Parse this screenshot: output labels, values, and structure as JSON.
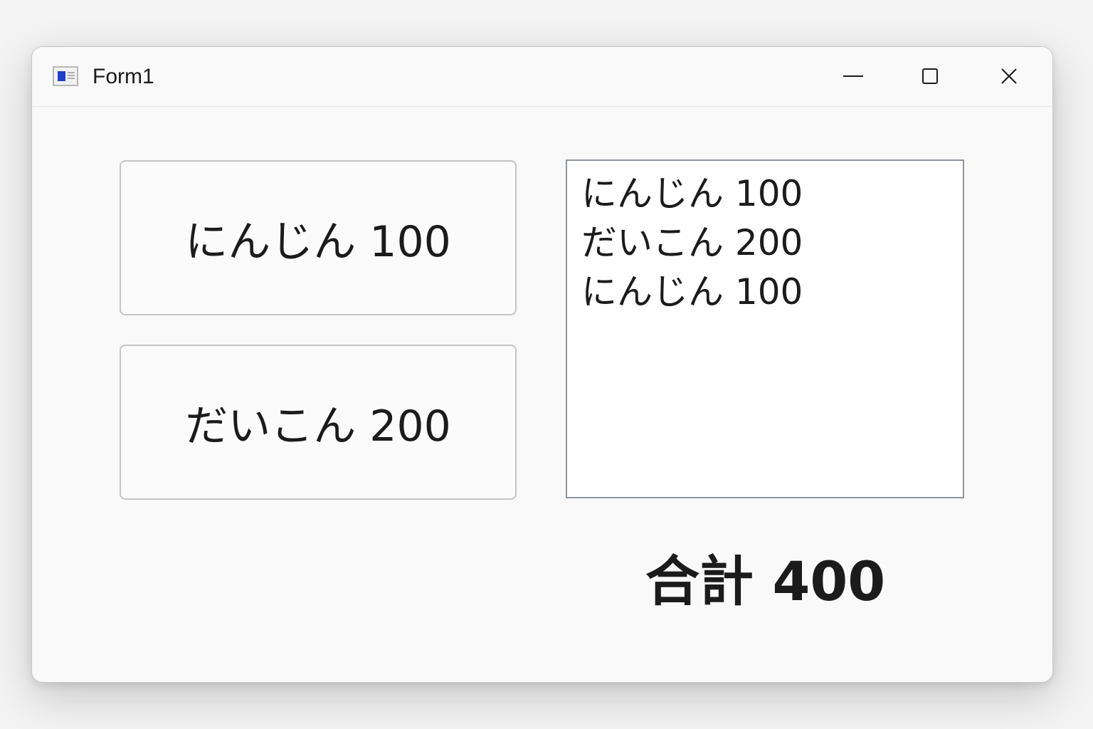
{
  "window": {
    "title": "Form1",
    "icon": "form-app-icon",
    "controls": {
      "minimize": "minimize-icon",
      "maximize": "maximize-icon",
      "close": "close-icon"
    }
  },
  "buttons": {
    "carrot": "にんじん 100",
    "daikon": "だいこん 200"
  },
  "listbox": {
    "items": [
      "にんじん 100",
      "だいこん 200",
      "にんじん 100"
    ]
  },
  "total": {
    "label": "合計 400"
  },
  "colors": {
    "window_bg": "#f9f9f9",
    "icon_accent": "#1f3fcf",
    "text": "#1b1b1b"
  }
}
